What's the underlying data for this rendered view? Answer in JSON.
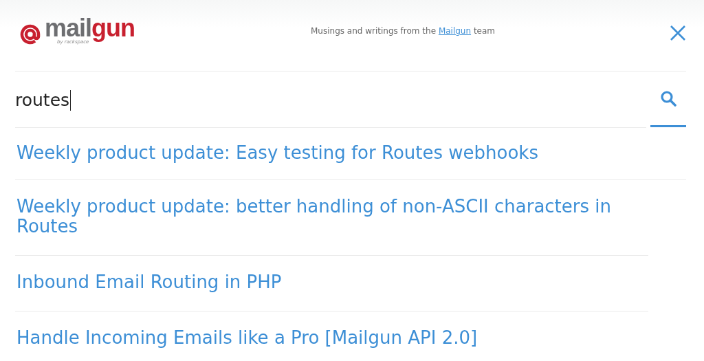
{
  "logo": {
    "mail": "mail",
    "gun": "gun",
    "byline": "by rackspace"
  },
  "tagline": {
    "before": "Musings and writings from the",
    "link": "Mailgun",
    "after": "team"
  },
  "search": {
    "value": "routes"
  },
  "results": [
    {
      "title": "Weekly product update: Easy testing for Routes webhooks"
    },
    {
      "title": "Weekly product update: better handling of non-ASCII characters in Routes"
    },
    {
      "title": "Inbound Email Routing in PHP"
    },
    {
      "title": "Handle Incoming Emails like a Pro [Mailgun API 2.0]"
    }
  ]
}
